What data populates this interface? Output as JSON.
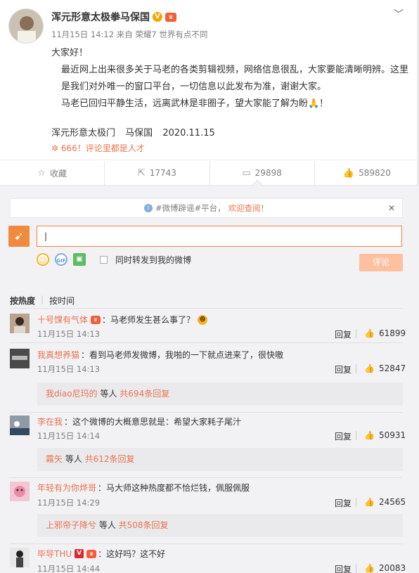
{
  "post": {
    "author": "浑元形意太极拳马保国",
    "meta": "11月15日 14:12 来自 荣耀7 世界有点不同",
    "greeting": "大家好！",
    "para1": "最近网上出来很多关于马老的各类剪辑视频，网络信息很乱，大家要能清晰明辨。这里是我们对外唯一的窗口平台，一切信息以此发布为准，谢谢大家。",
    "para2": "马老已回归平静生活，远离武林是非圈子，望大家能了解为盼🙏！",
    "sig_org": "浑元形意太极门",
    "sig_name": "马保国",
    "sig_date": "2020.11.15",
    "hot_comment": "666！评论里都是人才"
  },
  "actions": {
    "favorite": "收藏",
    "repost": "17743",
    "comments": "29898",
    "likes": "589820"
  },
  "comment_box": {
    "notice_prefix": "#微博辟谣#平台，",
    "notice_link": "欢迎查阅！",
    "repost_label": "同时转发到我的微博",
    "submit_label": "评论"
  },
  "sort": {
    "hot": "按热度",
    "time": "按时间"
  },
  "comments": [
    {
      "name": "十号馃有气体",
      "text": "：马老师发生甚么事了？",
      "time": "11月15日 14:13",
      "reply": "回复",
      "likes": "61899"
    },
    {
      "name": "我真想养猫",
      "text": "：看到马老师发微博，我啪的一下就点进来了，很快嗷",
      "time": "11月15日 14:13",
      "reply": "回复",
      "likes": "52847",
      "thread_user": "我diao尼玛的",
      "thread_mid": " 等人 ",
      "thread_count": "共694条回复"
    },
    {
      "name": "李在我",
      "text": "：这个微博的大概意思就是：希望大家耗子尾汁",
      "time": "11月15日 14:14",
      "reply": "回复",
      "likes": "50931",
      "thread_user": "霧矢",
      "thread_mid": " 等人 ",
      "thread_count": "共612条回复"
    },
    {
      "name": "年轻有为你烨哥",
      "text": "：马大师这种热度都不恰烂钱，佩服佩服",
      "time": "11月15日 14:29",
      "reply": "回复",
      "likes": "24565",
      "thread_user": "上邪帝子降兮",
      "thread_mid": " 等人 ",
      "thread_count": "共508条回复"
    },
    {
      "name": "毕导THU",
      "text": "：这好吗？这不好",
      "time": "11月15日 14:44",
      "reply": "回复",
      "likes": "20083"
    }
  ]
}
